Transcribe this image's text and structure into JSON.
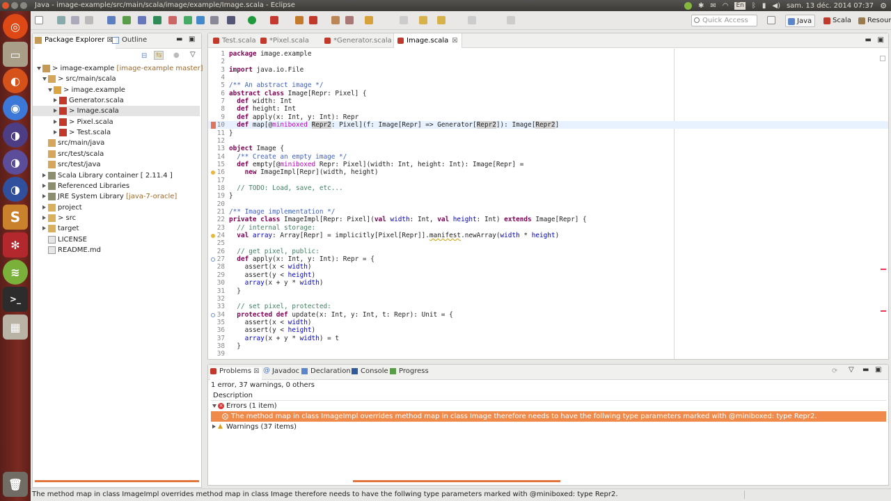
{
  "window": {
    "title": "Java - image-example/src/main/scala/image/example/Image.scala - Eclipse"
  },
  "tray": {
    "lang": "En",
    "datetime": "sam. 13 déc. 2014 07:37"
  },
  "quick_access": {
    "placeholder": "Quick Access"
  },
  "perspectives": [
    {
      "label": "Java",
      "active": true
    },
    {
      "label": "Scala",
      "active": false
    },
    {
      "label": "Resource",
      "active": false
    }
  ],
  "package_explorer": {
    "tab_label": "Package Explorer",
    "outline_label": "Outline",
    "tree": [
      {
        "label": "> image-example",
        "suffix": " [image-example master]",
        "depth": 0,
        "open": true,
        "twisty": true,
        "icon": "project"
      },
      {
        "label": "> src/main/scala",
        "depth": 1,
        "open": true,
        "twisty": true,
        "icon": "source-folder"
      },
      {
        "label": "> image.example",
        "depth": 2,
        "open": true,
        "twisty": true,
        "icon": "package"
      },
      {
        "label": "Generator.scala",
        "depth": 3,
        "twisty": true,
        "icon": "scala-file"
      },
      {
        "label": "> Image.scala",
        "depth": 3,
        "twisty": true,
        "icon": "scala-file",
        "selected": true
      },
      {
        "label": "> Pixel.scala",
        "depth": 3,
        "twisty": true,
        "icon": "scala-file"
      },
      {
        "label": "> Test.scala",
        "depth": 3,
        "twisty": true,
        "icon": "scala-file"
      },
      {
        "label": "src/main/java",
        "depth": 1,
        "icon": "source-folder"
      },
      {
        "label": "src/test/scala",
        "depth": 1,
        "icon": "source-folder"
      },
      {
        "label": "src/test/java",
        "depth": 1,
        "icon": "source-folder"
      },
      {
        "label": "Scala Library container [ 2.11.4 ]",
        "depth": 1,
        "twisty": true,
        "icon": "library"
      },
      {
        "label": "Referenced Libraries",
        "depth": 1,
        "twisty": true,
        "icon": "library"
      },
      {
        "label": "JRE System Library ",
        "suffix": "[java-7-oracle]",
        "depth": 1,
        "twisty": true,
        "icon": "library"
      },
      {
        "label": "project",
        "depth": 1,
        "twisty": true,
        "icon": "folder"
      },
      {
        "label": "> src",
        "depth": 1,
        "twisty": true,
        "icon": "folder"
      },
      {
        "label": "target",
        "depth": 1,
        "twisty": true,
        "icon": "folder"
      },
      {
        "label": "LICENSE",
        "depth": 1,
        "icon": "file"
      },
      {
        "label": "README.md",
        "depth": 1,
        "icon": "file"
      }
    ]
  },
  "editor": {
    "tabs": [
      {
        "label": "Test.scala",
        "active": false
      },
      {
        "label": "*Pixel.scala",
        "active": false
      },
      {
        "label": "*Generator.scala",
        "active": false
      },
      {
        "label": "Image.scala",
        "active": true,
        "close": "☒"
      }
    ],
    "highlight_line": 10,
    "lines": [
      "1|<span class=\"k\">package</span> image.example",
      "2|",
      "3|<span class=\"k\">import</span> java.io.File",
      "4|",
      "5|<span class=\"cm\">/** An abstract image */</span>",
      "6|<span class=\"k\">abstract class</span> Image[Repr: Pixel] {",
      "7|  <span class=\"k\">def</span> width: Int",
      "8|  <span class=\"k\">def</span> height: Int",
      "9|  <span class=\"k\">def</span> apply(x: Int, y: Int): Repr",
      "10|  <span class=\"k\">def</span> map[@<span class=\"mb\">miniboxed</span> <span class=\"hx\">Repr2</span>: Pixel](f: Image[Repr] => Generator[<span class=\"hx\">Repr2</span>]): Image[<span class=\"hx\">Repr2</span>]",
      "11|}",
      "12|",
      "13|<span class=\"k\">object</span> Image {",
      "14|  <span class=\"cm\">/** Create an empty image */</span>",
      "15|  <span class=\"k\">def</span> empty[@<span class=\"mb\">miniboxed</span> Repr: Pixel](width: Int, height: Int): Image[Repr] =",
      "16|    <span class=\"k\">new</span> ImageImpl[Repr](width, height)",
      "17|",
      "18|  <span class=\"lc\">// TODO: Load, save, etc...</span>",
      "19|}",
      "20|",
      "21|<span class=\"cm\">/** Image implementation */</span>",
      "22|<span class=\"k\">private class</span> ImageImpl[Repr: Pixel](<span class=\"k\">val</span> <span class=\"fd\">width</span>: Int, <span class=\"k\">val</span> <span class=\"fd\">height</span>: Int) <span class=\"k\">extends</span> Image[Repr] {",
      "23|  <span class=\"lc\">// internal storage:</span>",
      "24|  <span class=\"k\">val</span> <span class=\"fd\">array</span>: Array[Repr] = implicitly[Pixel[Repr]].<span class=\"wv\">manifest</span>.newArray(<span class=\"fd\">width</span> * <span class=\"fd\">height</span>)",
      "25|",
      "26|  <span class=\"lc\">// get pixel, public:</span>",
      "27|  <span class=\"k\">def</span> apply(x: Int, y: Int): Repr = {",
      "28|    assert(x < <span class=\"fd\">width</span>)",
      "29|    assert(y < <span class=\"fd\">height</span>)",
      "30|    <span class=\"fd\">array</span>(x + y * <span class=\"fd\">width</span>)",
      "31|  }",
      "32|",
      "33|  <span class=\"lc\">// set pixel, protected:</span>",
      "34|  <span class=\"k\">protected def</span> update(x: Int, y: Int, t: Repr): Unit = {",
      "35|    assert(x < <span class=\"fd\">width</span>)",
      "36|    assert(y < <span class=\"fd\">height</span>)",
      "37|    <span class=\"fd\">array</span>(x + y * <span class=\"fd\">width</span>) = t",
      "38|  }",
      "39|"
    ],
    "markers": {
      "10": "error",
      "16": "warning",
      "24": "warning",
      "27": "override",
      "34": "override"
    }
  },
  "problems": {
    "tabs": [
      {
        "label": "Problems",
        "active": true,
        "close": "☒"
      },
      {
        "label": "Javadoc"
      },
      {
        "label": "Declaration"
      },
      {
        "label": "Console"
      },
      {
        "label": "Progress"
      }
    ],
    "summary": "1 error, 37 warnings, 0 others",
    "column": "Description",
    "errors_group": "Errors (1 item)",
    "error_message": "The method map in class ImageImpl overrides method map in class Image therefore needs to have the follwing type parameters marked with @miniboxed: type Repr2.",
    "warnings_group": "Warnings (37 items)"
  },
  "status_bar": {
    "message": "The method map in class ImageImpl overrides method map in class Image therefore needs to have the follwing type parameters marked with @miniboxed: type Repr2."
  },
  "colors": {
    "error_row": "#f08a4b",
    "launcher": "#7a2a22",
    "keyword": "#7f0055",
    "comment": "#3f5fbf",
    "line_comment": "#3f7f5f"
  }
}
